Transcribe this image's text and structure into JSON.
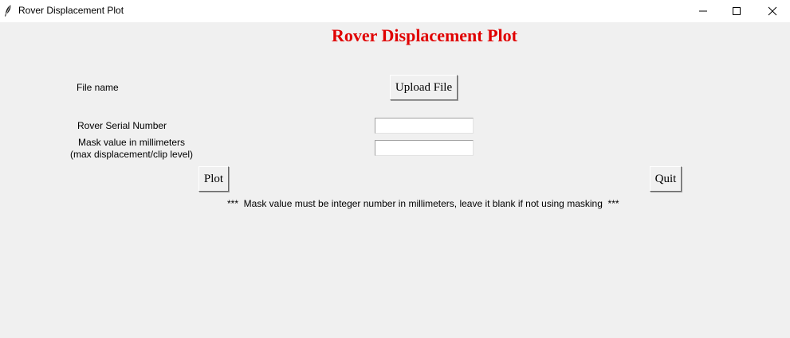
{
  "window": {
    "title": "Rover Displacement Plot",
    "icon": "feather-icon",
    "controls": [
      "minimize-icon",
      "maximize-icon",
      "close-icon"
    ]
  },
  "heading": {
    "text": "Rover Displacement Plot",
    "color": "#e00000"
  },
  "form": {
    "file_label": "File name",
    "upload_button": "Upload File",
    "serial_label": "Rover Serial Number",
    "serial_value": "",
    "mask_label": "Mask value in millimeters\n(max displacement/clip level)",
    "mask_value": ""
  },
  "actions": {
    "plot_button": "Plot",
    "quit_button": "Quit"
  },
  "note": "***  Mask value must be integer number in millimeters, leave it blank if not using masking  ***"
}
